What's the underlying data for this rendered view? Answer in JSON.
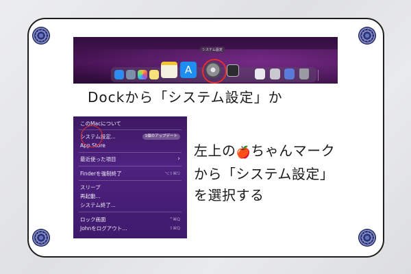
{
  "dock_screenshot": {
    "tooltip": "システム設定",
    "apps": [
      {
        "icon": "finder-icon",
        "color": "#2d8cf0"
      },
      {
        "icon": "launchpad-icon",
        "color": "#7a8fa8"
      },
      {
        "icon": "photos-icon",
        "color": "#f2b63c"
      },
      {
        "icon": "notes-icon",
        "color": "#f7e27a"
      },
      {
        "icon": "app-store-icon",
        "color": "#1e8ff0"
      },
      {
        "icon": "system-settings-icon",
        "color": "#8e8e93"
      },
      {
        "icon": "preview-icon",
        "color": "#5a5a62"
      },
      {
        "icon": "document-icon",
        "color": "#c9c9cf"
      },
      {
        "icon": "monitor-icon",
        "color": "#e8e8ee"
      },
      {
        "icon": "trash-icon",
        "color": "#9a9aa2"
      }
    ],
    "highlight_color": "#e53030"
  },
  "caption_1": "Dockから「システム設定」か",
  "apple_menu": {
    "items": [
      {
        "label": "このMacについて",
        "shortcut": ""
      },
      {
        "label": "システム設定...",
        "shortcut": "",
        "badge": "1個のアップデート"
      },
      {
        "label": "App Store",
        "shortcut": ""
      },
      {
        "label": "最近使った項目",
        "shortcut": "›"
      },
      {
        "label": "Finderを強制終了",
        "shortcut": "⌥⇧⌘⎋"
      },
      {
        "label": "スリープ",
        "shortcut": ""
      },
      {
        "label": "再起動...",
        "shortcut": ""
      },
      {
        "label": "システム終了...",
        "shortcut": ""
      },
      {
        "label": "ロック画面",
        "shortcut": "^⌘Q"
      },
      {
        "label": "Johnをログアウト...",
        "shortcut": "⇧⌘Q"
      }
    ]
  },
  "caption_2": {
    "line1_before": "左上の",
    "apple_symbol": "🍎",
    "line1_after": "ちゃんマーク",
    "line2": "から「システム設定」",
    "line3": "を選択する"
  },
  "colors": {
    "frame_border": "#1d1d1d",
    "emblem": "#2b3478",
    "accent_red": "#e53030"
  }
}
